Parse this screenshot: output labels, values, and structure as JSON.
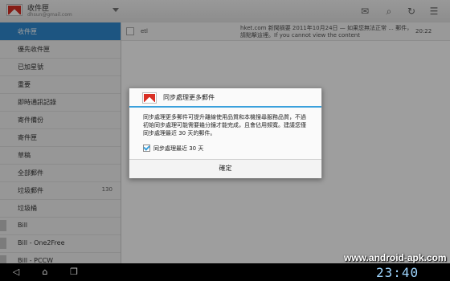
{
  "header": {
    "title": "收件匣",
    "account": "dhsun@gmail.com"
  },
  "toolbar": {
    "icons": [
      "compose-icon",
      "search-icon",
      "refresh-icon",
      "menu-icon"
    ]
  },
  "sidebar": {
    "items": [
      {
        "label": "收件匣",
        "count": "",
        "selected": true
      },
      {
        "label": "優先收件匣",
        "count": ""
      },
      {
        "label": "已加星號",
        "count": ""
      },
      {
        "label": "重要",
        "count": ""
      },
      {
        "label": "即時通訊記錄",
        "count": ""
      },
      {
        "label": "寄件備份",
        "count": ""
      },
      {
        "label": "寄件匣",
        "count": ""
      },
      {
        "label": "草稿",
        "count": ""
      },
      {
        "label": "全部郵件",
        "count": ""
      },
      {
        "label": "垃圾郵件",
        "count": "130"
      },
      {
        "label": "垃圾桶",
        "count": ""
      },
      {
        "label": "Bill",
        "count": ""
      },
      {
        "label": "Bill - One2Free",
        "count": ""
      },
      {
        "label": "Bill - PCCW",
        "count": ""
      }
    ]
  },
  "messages": [
    {
      "from": "etl",
      "subject": "hket.com 新聞摘要 2011年10月24日 — 如果您無法正常 ... 郵件，請點擊這裡。If you cannot view the content",
      "time": "20:22"
    }
  ],
  "dialog": {
    "title": "同步處理更多郵件",
    "body": "同步處理更多郵件可提升離線使用品質和本機搜尋服務品質，不過初始同步處理可能需要幾分鐘才能完成，且會佔用頻寬。建議您僅同步處理最近 30 天的郵件。",
    "checkbox_label": "同步處理最近 30 天",
    "checkbox_checked": true,
    "ok_label": "確定"
  },
  "system_bar": {
    "nav_icons": [
      "back-icon",
      "home-icon",
      "recent-apps-icon"
    ],
    "clock": "23:40"
  },
  "watermark": "www.android-apk.com",
  "colors": {
    "accent": "#3aa0dc",
    "selected": "#2f8ad0",
    "gmail_red": "#d93025"
  }
}
